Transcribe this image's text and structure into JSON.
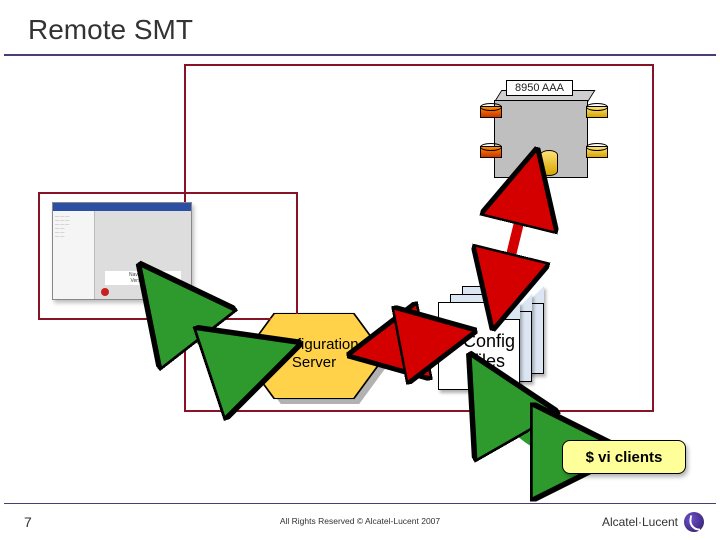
{
  "title": "Remote SMT",
  "server": {
    "label": "8950 AAA"
  },
  "hex": {
    "line1": "Configuration",
    "line2": "Server"
  },
  "files": {
    "line1": "Config",
    "line2": "files"
  },
  "callout": {
    "text": "$ vi clients"
  },
  "client_window": {
    "banner_title": "NavisRadius",
    "banner_sub": "Version 4.0"
  },
  "footer": {
    "page": "7",
    "copyright": "All Rights Reserved © Alcatel-Lucent 2007",
    "brand": "Alcatel·Lucent"
  }
}
